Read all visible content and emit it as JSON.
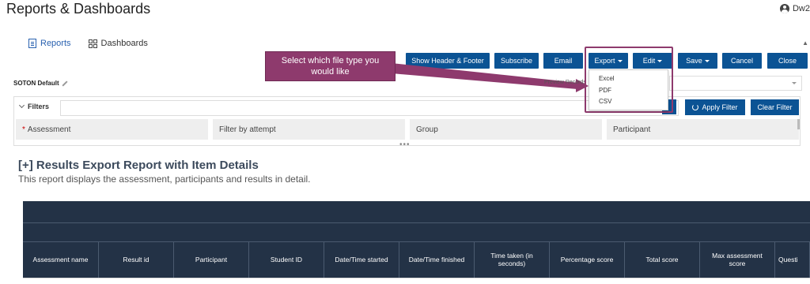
{
  "app": {
    "title": "Reports & Dashboards",
    "user": "Dw2"
  },
  "nav": {
    "reports": "Reports",
    "dashboards": "Dashboards"
  },
  "toolbar": {
    "show_header_footer": "Show Header & Footer",
    "subscribe": "Subscribe",
    "email": "Email",
    "export": "Export",
    "edit": "Edit",
    "save": "Save",
    "cancel": "Cancel",
    "close": "Close"
  },
  "callout": {
    "text": "Select which file type you would like"
  },
  "export_menu": [
    "Excel",
    "PDF",
    "CSV"
  ],
  "report_name": "SOTON Default",
  "preview_label": "Preview Records",
  "filters": {
    "label": "Filters",
    "apply": "Apply Filter",
    "clear": "Clear Filter",
    "fields": [
      "Assessment",
      "Filter by attempt",
      "Group",
      "Participant"
    ],
    "required_marker": "*"
  },
  "report": {
    "title": "[+] Results Export Report with Item Details",
    "description": "This report displays the assessment, participants and results in detail."
  },
  "table": {
    "columns": [
      "Assessment name",
      "Result id",
      "Participant",
      "Student ID",
      "Date/Time started",
      "Date/Time finished",
      "Time taken (in seconds)",
      "Percentage score",
      "Total score",
      "Max assessment score",
      "Questi"
    ]
  },
  "colors": {
    "primary": "#0b5394",
    "callout": "#8e3a6d",
    "table_header": "#233246"
  }
}
